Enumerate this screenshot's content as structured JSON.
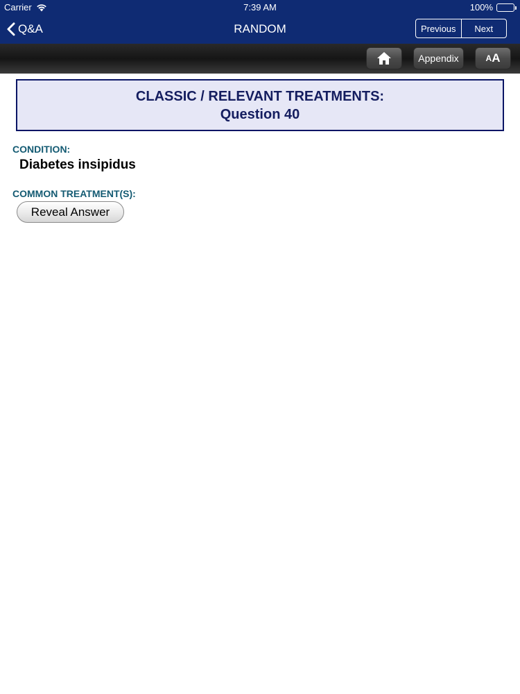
{
  "status_bar": {
    "carrier": "Carrier",
    "time": "7:39 AM",
    "battery": "100%",
    "battery_level": 1.0
  },
  "nav": {
    "back_label": "Q&A",
    "title": "RANDOM",
    "previous_label": "Previous",
    "next_label": "Next"
  },
  "toolbar": {
    "home_icon": "house-icon",
    "appendix_label": "Appendix",
    "font_size_small": "A",
    "font_size_large": "A"
  },
  "question": {
    "heading": "CLASSIC / RELEVANT TREATMENTS:",
    "number": "Question 40"
  },
  "condition": {
    "label": "CONDITION:",
    "value": "Diabetes insipidus"
  },
  "treatment": {
    "label": "COMMON TREATMENT(S):",
    "reveal_label": "Reveal Answer"
  },
  "colors": {
    "nav_bar": "#0f2b73",
    "question_box_bg": "#e6e7f6",
    "question_text": "#141d5f",
    "section_label": "#135a72"
  }
}
